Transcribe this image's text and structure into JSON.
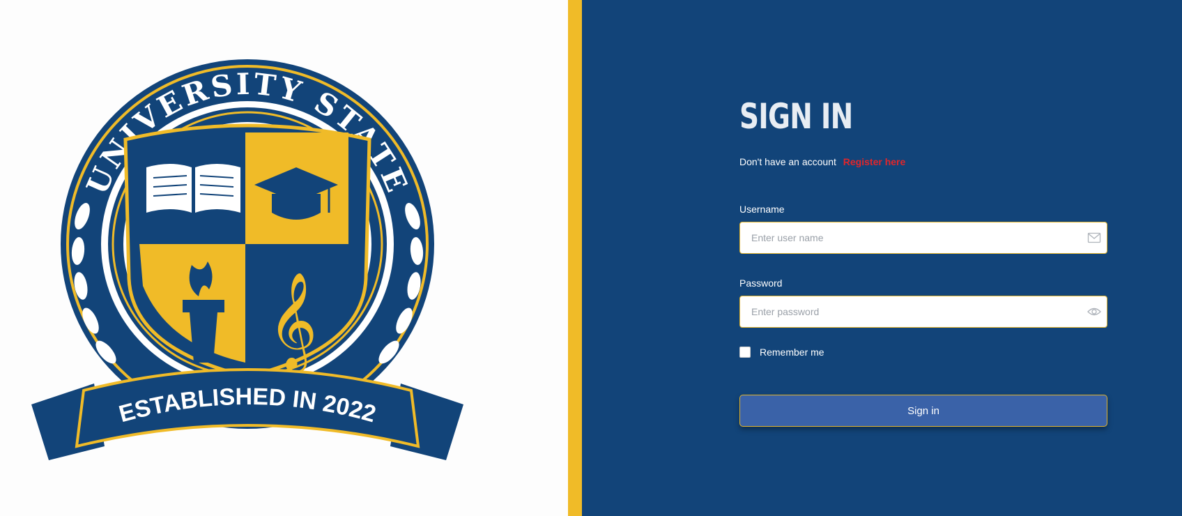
{
  "theme": {
    "navy": "#124479",
    "gold": "#f0bb28",
    "button_blue": "#3a62a8",
    "link_red": "#e0262b"
  },
  "seal": {
    "top_text": "UNIVERSITY STATE",
    "banner_text": "ESTABLISHED IN 2022"
  },
  "form": {
    "title": "SIGN IN",
    "register_prompt": "Don't have an account",
    "register_link": "Register here",
    "username_label": "Username",
    "username_placeholder": "Enter user name",
    "username_icon": "envelope-icon",
    "password_label": "Password",
    "password_placeholder": "Enter password",
    "password_icon": "eye-icon",
    "remember_label": "Remember me",
    "remember_checked": false,
    "submit_label": "Sign in"
  }
}
